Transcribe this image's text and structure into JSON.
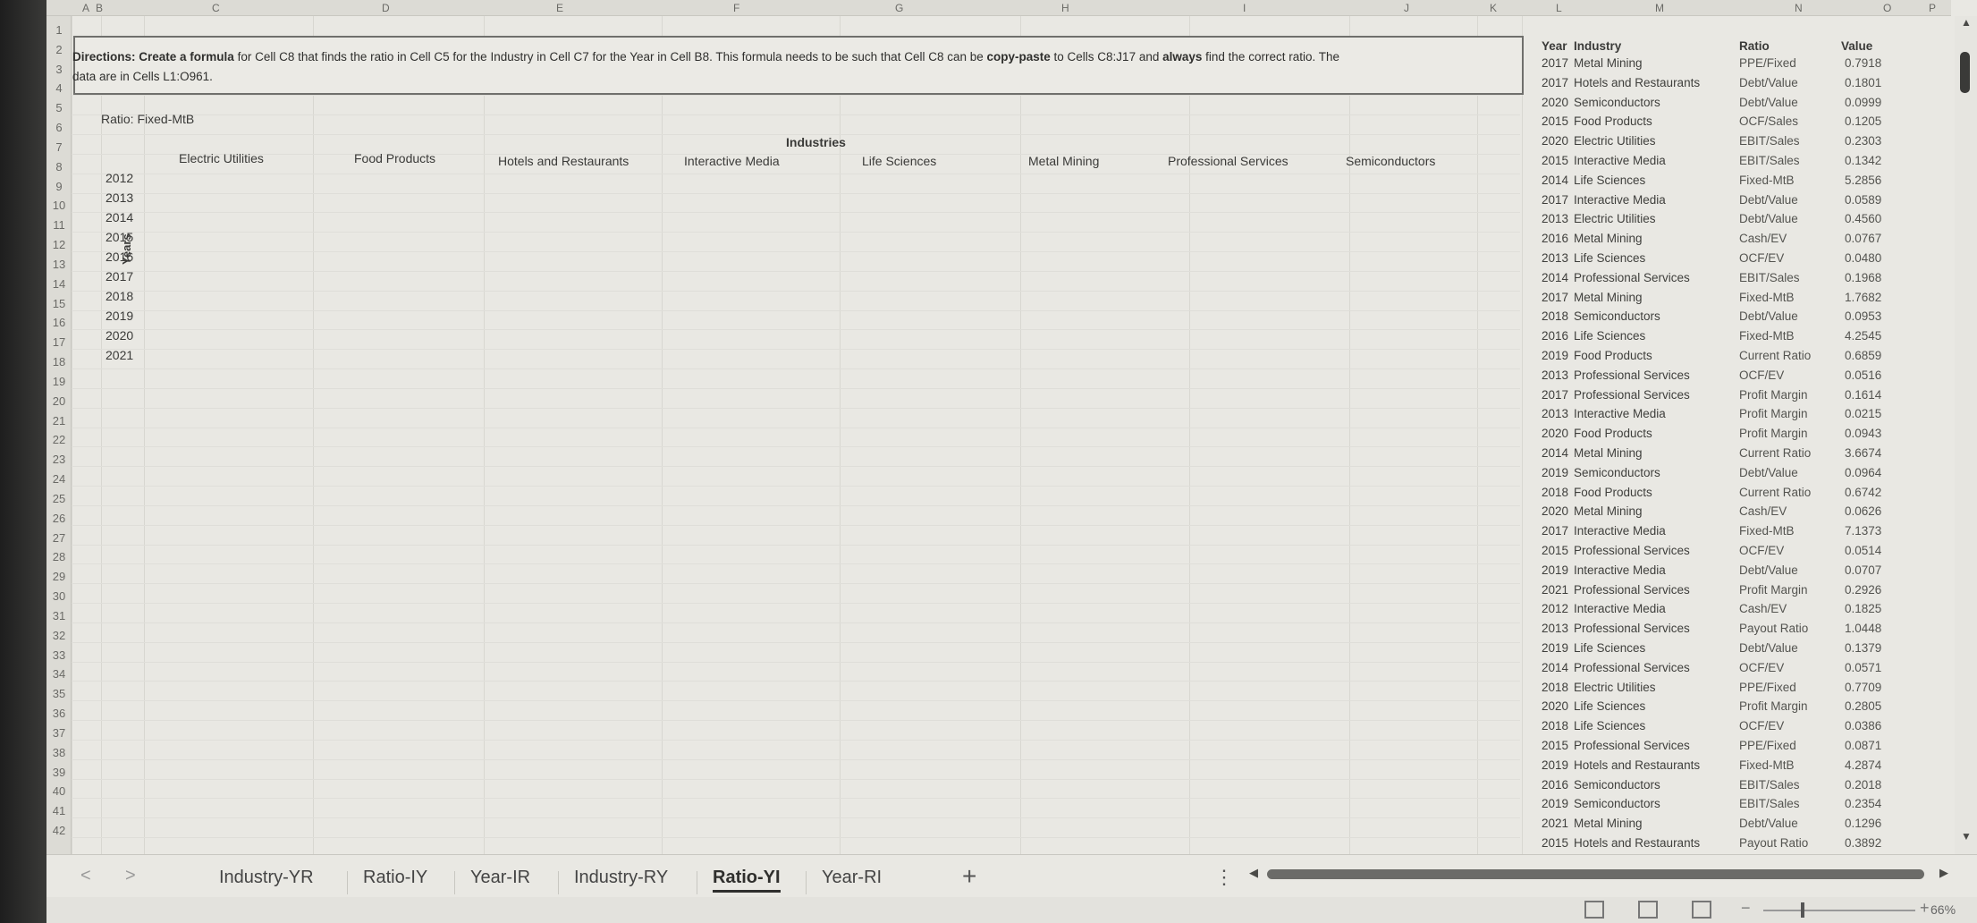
{
  "columns": [
    "A",
    "B",
    "C",
    "D",
    "E",
    "F",
    "G",
    "H",
    "I",
    "J",
    "K",
    "L",
    "M",
    "N",
    "O",
    "P"
  ],
  "rows": [
    "1",
    "2",
    "3",
    "4",
    "5",
    "6",
    "7",
    "8",
    "9",
    "10",
    "11",
    "12",
    "13",
    "14",
    "15",
    "16",
    "17",
    "18",
    "19",
    "20",
    "21",
    "22",
    "23",
    "24",
    "25",
    "26",
    "27",
    "28",
    "29",
    "30",
    "31",
    "32",
    "33",
    "34",
    "35",
    "36",
    "37",
    "38",
    "39",
    "40",
    "41",
    "42"
  ],
  "directions": {
    "prefix": "Directions: ",
    "bold1": "Create a formula",
    "mid1": " for Cell C8 that finds the ratio in Cell C5 for the Industry in Cell C7 for the Year in Cell B8.  This formula needs to be such that Cell C8 can be ",
    "bold2": "copy-paste",
    "mid2": " to Cells C8:J17 and ",
    "bold3": "always",
    "mid3": " find the correct ratio.  The",
    "line2": "data are in Cells L1:O961."
  },
  "ratio_label": "Ratio:",
  "ratio_value": "Fixed-MtB",
  "industries_title": "Industries",
  "years_title": "Years",
  "industries": [
    "Electric Utilities",
    "Food Products",
    "Hotels and Restaurants",
    "Interactive Media",
    "Life Sciences",
    "Metal Mining",
    "Professional Services",
    "Semiconductors"
  ],
  "years": [
    "2012",
    "2013",
    "2014",
    "2015",
    "2016",
    "2017",
    "2018",
    "2019",
    "2020",
    "2021"
  ],
  "data_headers": {
    "year": "Year",
    "industry": "Industry",
    "ratio": "Ratio",
    "value": "Value"
  },
  "data_rows": [
    [
      "2017",
      "Metal Mining",
      "PPE/Fixed",
      "0.7918"
    ],
    [
      "2017",
      "Hotels and Restaurants",
      "Debt/Value",
      "0.1801"
    ],
    [
      "2020",
      "Semiconductors",
      "Debt/Value",
      "0.0999"
    ],
    [
      "2015",
      "Food Products",
      "OCF/Sales",
      "0.1205"
    ],
    [
      "2020",
      "Electric Utilities",
      "EBIT/Sales",
      "0.2303"
    ],
    [
      "2015",
      "Interactive Media",
      "EBIT/Sales",
      "0.1342"
    ],
    [
      "2014",
      "Life Sciences",
      "Fixed-MtB",
      "5.2856"
    ],
    [
      "2017",
      "Interactive Media",
      "Debt/Value",
      "0.0589"
    ],
    [
      "2013",
      "Electric Utilities",
      "Debt/Value",
      "0.4560"
    ],
    [
      "2016",
      "Metal Mining",
      "Cash/EV",
      "0.0767"
    ],
    [
      "2013",
      "Life Sciences",
      "OCF/EV",
      "0.0480"
    ],
    [
      "2014",
      "Professional Services",
      "EBIT/Sales",
      "0.1968"
    ],
    [
      "2017",
      "Metal Mining",
      "Fixed-MtB",
      "1.7682"
    ],
    [
      "2018",
      "Semiconductors",
      "Debt/Value",
      "0.0953"
    ],
    [
      "2016",
      "Life Sciences",
      "Fixed-MtB",
      "4.2545"
    ],
    [
      "2019",
      "Food Products",
      "Current Ratio",
      "0.6859"
    ],
    [
      "2013",
      "Professional Services",
      "OCF/EV",
      "0.0516"
    ],
    [
      "2017",
      "Professional Services",
      "Profit Margin",
      "0.1614"
    ],
    [
      "2013",
      "Interactive Media",
      "Profit Margin",
      "0.0215"
    ],
    [
      "2020",
      "Food Products",
      "Profit Margin",
      "0.0943"
    ],
    [
      "2014",
      "Metal Mining",
      "Current Ratio",
      "3.6674"
    ],
    [
      "2019",
      "Semiconductors",
      "Debt/Value",
      "0.0964"
    ],
    [
      "2018",
      "Food Products",
      "Current Ratio",
      "0.6742"
    ],
    [
      "2020",
      "Metal Mining",
      "Cash/EV",
      "0.0626"
    ],
    [
      "2017",
      "Interactive Media",
      "Fixed-MtB",
      "7.1373"
    ],
    [
      "2015",
      "Professional Services",
      "OCF/EV",
      "0.0514"
    ],
    [
      "2019",
      "Interactive Media",
      "Debt/Value",
      "0.0707"
    ],
    [
      "2021",
      "Professional Services",
      "Profit Margin",
      "0.2926"
    ],
    [
      "2012",
      "Interactive Media",
      "Cash/EV",
      "0.1825"
    ],
    [
      "2013",
      "Professional Services",
      "Payout Ratio",
      "1.0448"
    ],
    [
      "2019",
      "Life Sciences",
      "Debt/Value",
      "0.1379"
    ],
    [
      "2014",
      "Professional Services",
      "OCF/EV",
      "0.0571"
    ],
    [
      "2018",
      "Electric Utilities",
      "PPE/Fixed",
      "0.7709"
    ],
    [
      "2020",
      "Life Sciences",
      "Profit Margin",
      "0.2805"
    ],
    [
      "2018",
      "Life Sciences",
      "OCF/EV",
      "0.0386"
    ],
    [
      "2015",
      "Professional Services",
      "PPE/Fixed",
      "0.0871"
    ],
    [
      "2019",
      "Hotels and Restaurants",
      "Fixed-MtB",
      "4.2874"
    ],
    [
      "2016",
      "Semiconductors",
      "EBIT/Sales",
      "0.2018"
    ],
    [
      "2019",
      "Semiconductors",
      "EBIT/Sales",
      "0.2354"
    ],
    [
      "2021",
      "Metal Mining",
      "Debt/Value",
      "0.1296"
    ],
    [
      "2015",
      "Hotels and Restaurants",
      "Payout Ratio",
      "0.3892"
    ]
  ],
  "tabs": [
    "Industry-YR",
    "Ratio-IY",
    "Year-IR",
    "Industry-RY",
    "Ratio-YI",
    "Year-RI"
  ],
  "active_tab": "Ratio-YI",
  "add_sheet": "+",
  "more": "⋮",
  "zoom": "66%",
  "icons": {
    "prev": "chevron-left-icon",
    "next": "chevron-right-icon",
    "normal": "grid-view-icon",
    "layout": "page-layout-icon",
    "break": "page-break-icon"
  }
}
